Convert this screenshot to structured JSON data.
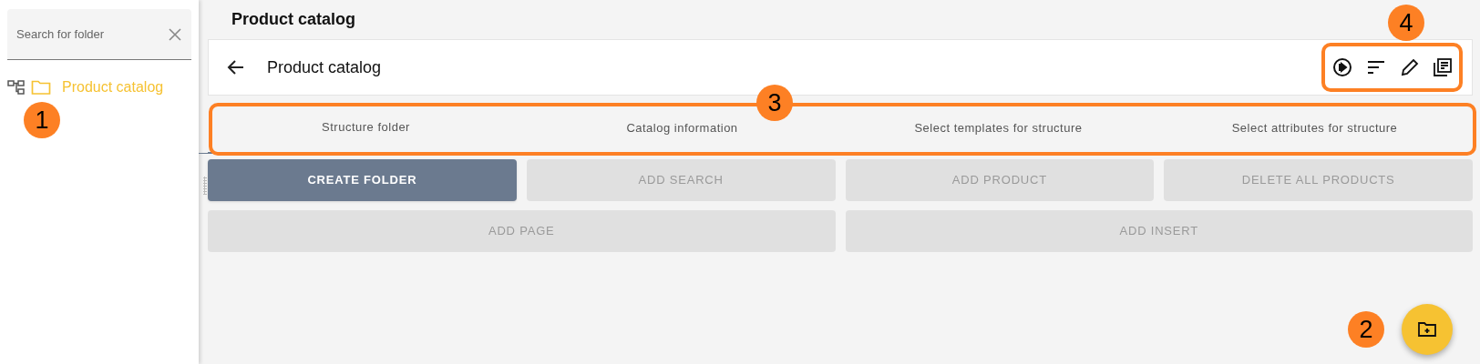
{
  "sidebar": {
    "search": {
      "placeholder": "Search for folder"
    },
    "tree": [
      {
        "label": "Product catalog",
        "selected": true
      }
    ]
  },
  "page_title": "Product catalog",
  "header": {
    "title": "Product catalog"
  },
  "tabs": [
    {
      "label": "Structure folder",
      "selected": true
    },
    {
      "label": "Catalog information",
      "selected": false
    },
    {
      "label": "Select templates for structure",
      "selected": false
    },
    {
      "label": "Select attributes for structure",
      "selected": false
    }
  ],
  "button_rows": [
    [
      {
        "label": "CREATE FOLDER",
        "disabled": false
      },
      {
        "label": "ADD SEARCH",
        "disabled": true
      },
      {
        "label": "ADD PRODUCT",
        "disabled": true
      },
      {
        "label": "DELETE ALL PRODUCTS",
        "disabled": true
      }
    ],
    [
      {
        "label": "ADD PAGE",
        "disabled": true
      },
      {
        "label": "ADD INSERT",
        "disabled": true
      }
    ]
  ],
  "callouts": [
    "1",
    "2",
    "3",
    "4"
  ]
}
